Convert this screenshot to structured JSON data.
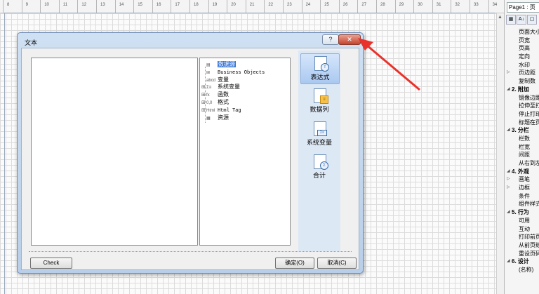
{
  "ruler": {
    "ticks": [
      "8",
      "9",
      "10",
      "11",
      "12",
      "13",
      "14",
      "15",
      "16",
      "17",
      "18",
      "19",
      "20",
      "21",
      "22",
      "23",
      "24",
      "25",
      "26",
      "27",
      "28",
      "29",
      "30",
      "31",
      "32",
      "33",
      "34"
    ]
  },
  "panel": {
    "title": "Page1 : 页",
    "toolbar": [
      "grid-icon",
      "sort-az-icon",
      "page-icon"
    ],
    "rows": [
      {
        "type": "item",
        "label": "页面大小"
      },
      {
        "type": "item",
        "label": "页宽"
      },
      {
        "type": "item",
        "label": "页高"
      },
      {
        "type": "item",
        "label": "定向"
      },
      {
        "type": "item",
        "label": "水印"
      },
      {
        "type": "item",
        "label": "页边距",
        "arrow": "▷"
      },
      {
        "type": "item",
        "label": "复制数"
      },
      {
        "type": "group",
        "label": "2. 附加",
        "arrow": "◢"
      },
      {
        "type": "item",
        "label": "镜像边距"
      },
      {
        "type": "item",
        "label": "拉伸至打印"
      },
      {
        "type": "item",
        "label": "停止打印"
      },
      {
        "type": "item",
        "label": "标题在页面"
      },
      {
        "type": "group",
        "label": "3. 分栏",
        "arrow": "◢"
      },
      {
        "type": "item",
        "label": "栏数"
      },
      {
        "type": "item",
        "label": "栏宽"
      },
      {
        "type": "item",
        "label": "间距"
      },
      {
        "type": "item",
        "label": "从右到左"
      },
      {
        "type": "group",
        "label": "4. 外观",
        "arrow": "◢"
      },
      {
        "type": "item",
        "label": "画笔",
        "arrow": "▷"
      },
      {
        "type": "item",
        "label": "边框",
        "arrow": "▷"
      },
      {
        "type": "item",
        "label": "条件"
      },
      {
        "type": "item",
        "label": "组件样式"
      },
      {
        "type": "group",
        "label": "5. 行为",
        "arrow": "◢"
      },
      {
        "type": "item",
        "label": "可用"
      },
      {
        "type": "item",
        "label": "互动"
      },
      {
        "type": "item",
        "label": "打印前页"
      },
      {
        "type": "item",
        "label": "从前页继续"
      },
      {
        "type": "item",
        "label": "重设页码"
      },
      {
        "type": "group",
        "label": "6. 设计",
        "arrow": "◢"
      },
      {
        "type": "item",
        "label": "(名称)"
      }
    ]
  },
  "dialog": {
    "title": "文本",
    "help_label": "?",
    "close_label": "✕",
    "tree": [
      {
        "label": "数据源",
        "icon": "▤",
        "selected": true
      },
      {
        "label": "Business Objects",
        "icon": "⊞",
        "mono": true
      },
      {
        "label": "变量",
        "icon": "abcd"
      },
      {
        "label": "系统变量",
        "icon": "Σ≡",
        "expander": "⊞"
      },
      {
        "label": "函数",
        "icon": "fx",
        "expander": "⊞"
      },
      {
        "label": "格式",
        "icon": "0,0",
        "expander": "⊞"
      },
      {
        "label": "Html Tag",
        "icon": "Html",
        "expander": "⊞",
        "mono": true
      },
      {
        "label": "资源",
        "icon": "▦"
      }
    ],
    "sidebar": [
      {
        "label": "表达式",
        "badge": "f",
        "active": true
      },
      {
        "label": "数据列",
        "badge": "≡"
      },
      {
        "label": "系统变量",
        "badge": "Σ≡"
      },
      {
        "label": "合计",
        "badge": "Σ"
      }
    ],
    "check_label": "Check",
    "ok_label": "确定(O)",
    "cancel_label": "取消(C)"
  },
  "colors": {
    "annotation_arrow": "#e8322b",
    "selection": "#3875d7",
    "sidebar_active": "#a9c8f0"
  }
}
